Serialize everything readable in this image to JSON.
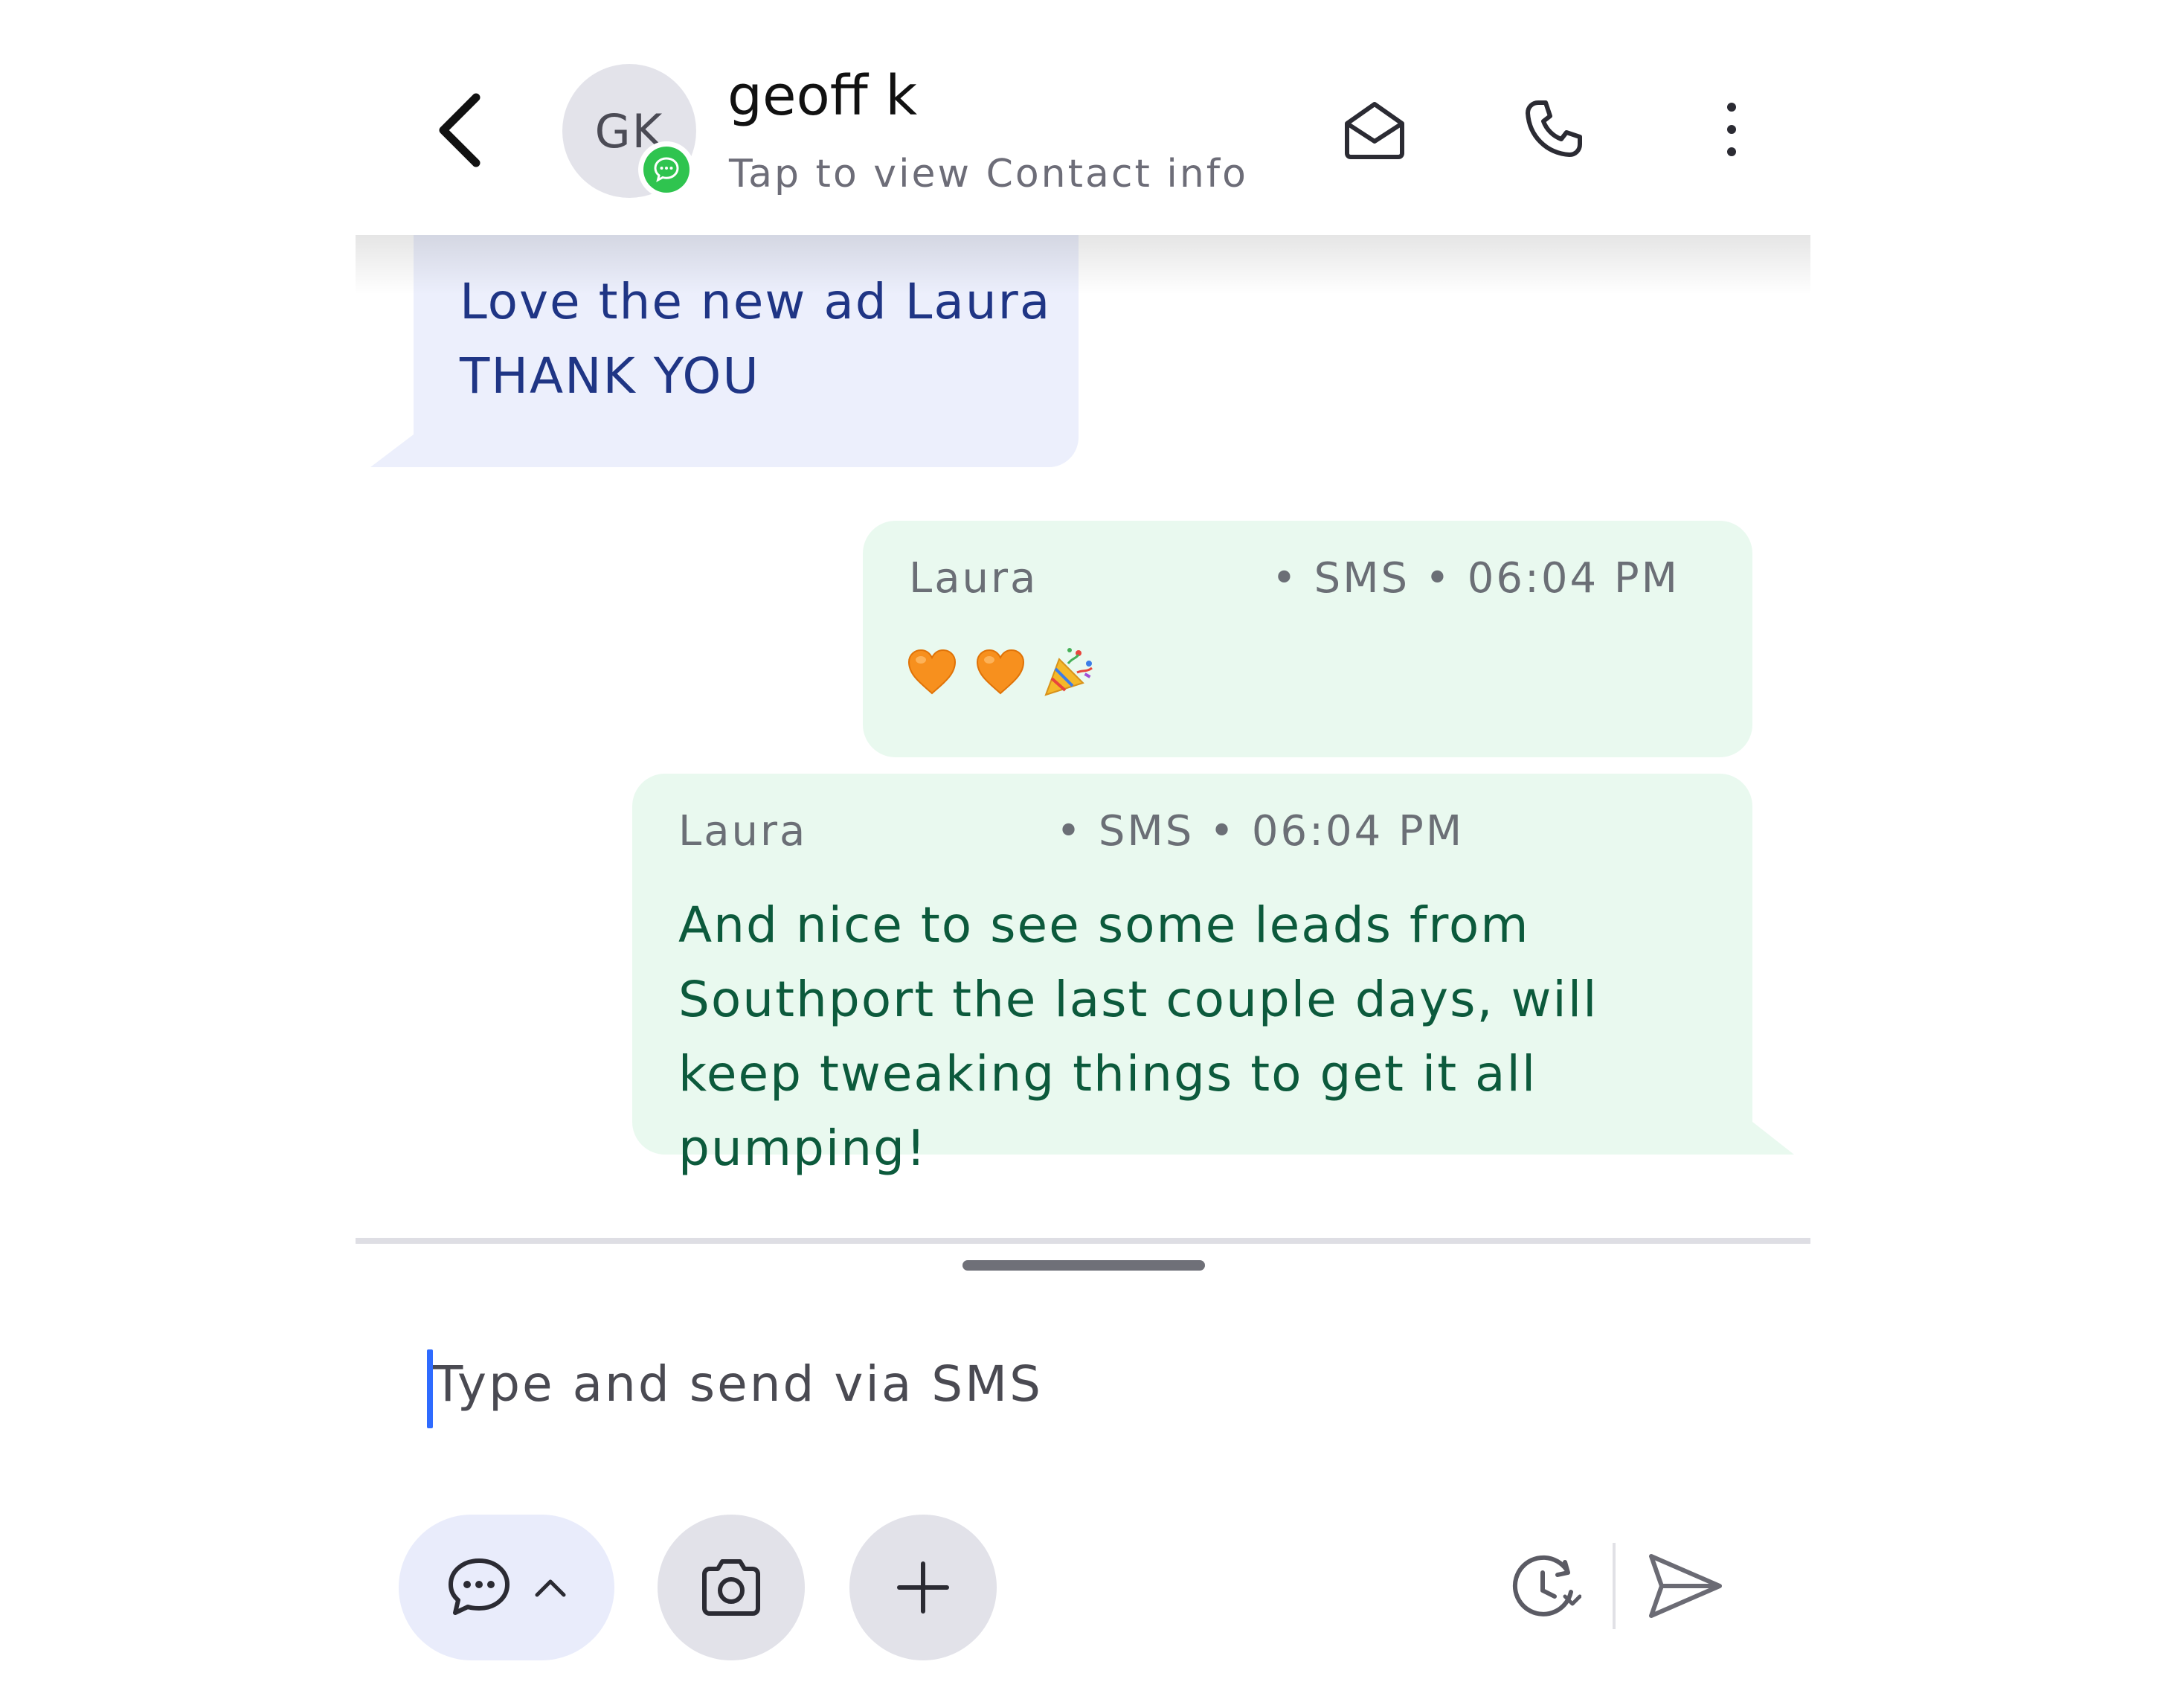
{
  "header": {
    "back_icon": "chevron-left-icon",
    "avatar_initials": "GK",
    "avatar_badge_icon": "sms-chat-icon",
    "contact_name": "geoff k",
    "contact_subtitle": "Tap to view Contact info",
    "actions": [
      "envelope-icon",
      "phone-icon",
      "more-vertical-icon"
    ]
  },
  "messages": [
    {
      "direction": "incoming",
      "text_line1": "Love the new ad Laura",
      "text_line2": "THANK YOU",
      "color": "#1f3585",
      "bubble_color": "#eceffc"
    },
    {
      "direction": "outgoing",
      "sender": "Laura",
      "meta": "• SMS • 06:04 PM",
      "emojis": [
        "orange-heart",
        "orange-heart",
        "party-popper"
      ],
      "bubble_color": "#e9f9ef"
    },
    {
      "direction": "outgoing",
      "sender": "Laura",
      "meta": "• SMS • 06:04 PM",
      "text": "And nice to see some leads from Southport the last couple days, will keep tweaking things to get it all pumping!",
      "color": "#0c5a3c",
      "bubble_color": "#e9f9ef"
    }
  ],
  "composer": {
    "placeholder": "Type and send via SMS",
    "value": "",
    "caret_color": "#2f6bff",
    "toolbar": {
      "templates_icon": "chat-bubble-icon",
      "templates_toggle_icon": "chevron-up-icon",
      "camera_icon": "camera-icon",
      "add_icon": "plus-icon",
      "schedule_icon": "clock-schedule-icon",
      "send_icon": "send-icon"
    }
  },
  "colors": {
    "accent_blue": "#2f6bff",
    "sms_badge_green": "#2fc44f",
    "incoming_bubble": "#eceffc",
    "outgoing_bubble": "#e9f9ef"
  }
}
